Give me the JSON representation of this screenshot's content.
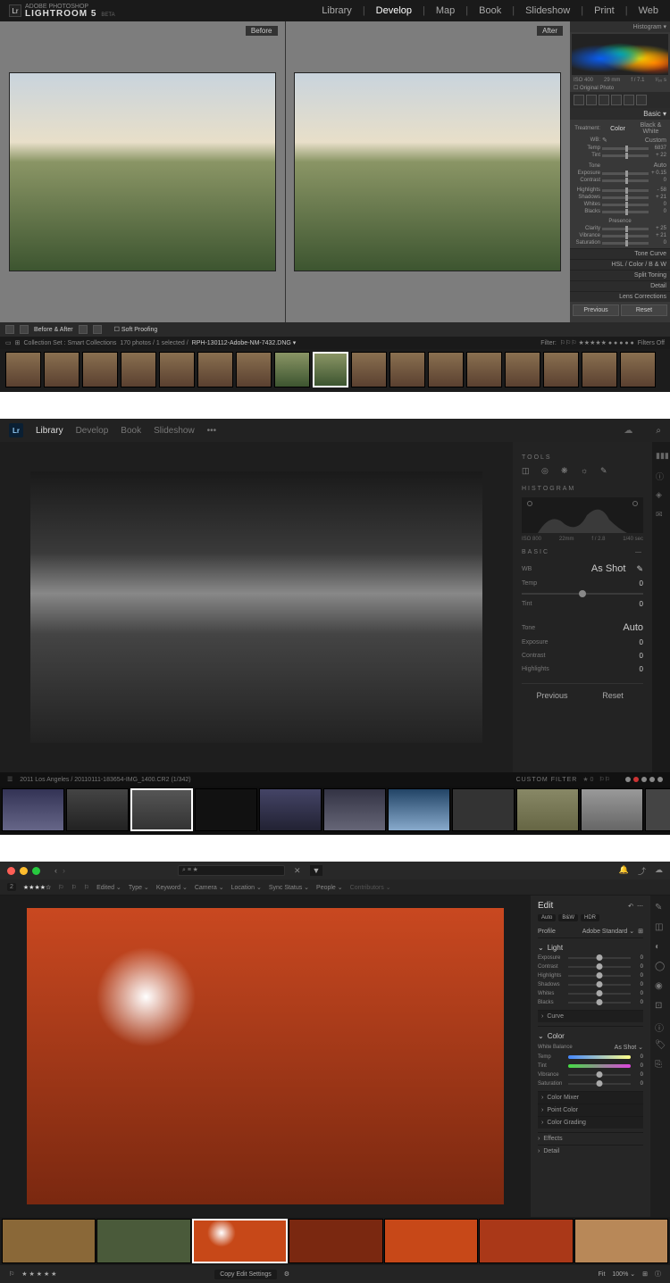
{
  "lr5": {
    "brand_small": "ADOBE PHOTOSHOP",
    "brand_big": "LIGHTROOM 5",
    "brand_beta": "BETA",
    "logo": "Lr",
    "modules": [
      "Library",
      "Develop",
      "Map",
      "Book",
      "Slideshow",
      "Print",
      "Web"
    ],
    "active_module": "Develop",
    "before_label": "Before",
    "after_label": "After",
    "histogram_title": "Histogram ▾",
    "hist_meta": {
      "iso": "ISO 400",
      "focal": "29 mm",
      "aperture": "f / 7.1",
      "shutter": "¹⁄₆₀ s"
    },
    "original_photo": "Original Photo",
    "basic_title": "Basic ▾",
    "treatment": {
      "label": "Treatment:",
      "color": "Color",
      "bw": "Black & White"
    },
    "wb": {
      "label": "WB:",
      "value": "Custom"
    },
    "temp": {
      "label": "Temp",
      "value": "6837"
    },
    "tint": {
      "label": "Tint",
      "value": "+ 22"
    },
    "tone_label": "Tone",
    "auto_label": "Auto",
    "exposure": {
      "label": "Exposure",
      "value": "+ 0.15"
    },
    "contrast": {
      "label": "Contrast",
      "value": "0"
    },
    "highlights": {
      "label": "Highlights",
      "value": "- 58"
    },
    "shadows": {
      "label": "Shadows",
      "value": "+ 21"
    },
    "whites": {
      "label": "Whites",
      "value": "0"
    },
    "blacks": {
      "label": "Blacks",
      "value": "0"
    },
    "presence_label": "Presence",
    "clarity": {
      "label": "Clarity",
      "value": "+ 25"
    },
    "vibrance": {
      "label": "Vibrance",
      "value": "+ 21"
    },
    "saturation": {
      "label": "Saturation",
      "value": "0"
    },
    "collapsed": [
      "Tone Curve",
      "HSL  /  Color  /  B & W",
      "Split Toning",
      "Detail",
      "Lens Corrections"
    ],
    "previous_btn": "Previous",
    "reset_btn": "Reset",
    "toolbar": {
      "mode": "Before & After",
      "soft": "Soft Proofing"
    },
    "filmstrip_header": {
      "collection": "Collection Set : Smart Collections",
      "count": "170 photos / 1 selected /",
      "file": "RPH-130112-Adobe-NM-7432.DNG ▾",
      "filter_label": "Filter:",
      "filters_off": "Filters Off"
    }
  },
  "lrcc": {
    "logo": "Lr",
    "modules": [
      "Library",
      "Develop",
      "Book",
      "Slideshow",
      "•••"
    ],
    "active": "Library",
    "tools_title": "TOOLS",
    "histogram_title": "HISTOGRAM",
    "meta": {
      "iso": "ISO 800",
      "focal": "22mm",
      "aperture": "f / 2.8",
      "shutter": "1/40 sec"
    },
    "basic_title": "BASIC",
    "wb": {
      "label": "WB",
      "value": "As Shot"
    },
    "temp": {
      "label": "Temp",
      "value": "0"
    },
    "tint": {
      "label": "Tint",
      "value": "0"
    },
    "tone": {
      "label": "Tone",
      "value": "Auto"
    },
    "exposure": {
      "label": "Exposure",
      "value": "0"
    },
    "contrast": {
      "label": "Contrast",
      "value": "0"
    },
    "highlights": {
      "label": "Highlights",
      "value": "0"
    },
    "previous_btn": "Previous",
    "reset_btn": "Reset",
    "breadcrumb": "2011 Los Angeles  /  20110111-183654-IMG_1400.CR2 (1/342)",
    "custom_filter": "CUSTOM FILTER",
    "star": "★ 0",
    "dot_colors": [
      "#888",
      "#888",
      "#c33",
      "#888",
      "#888",
      "#888"
    ]
  },
  "lr3": {
    "traffic": [
      "#ff5f56",
      "#ffbd2e",
      "#27c93f"
    ],
    "search_text": "⌕  ≡ ★",
    "rating_display": "★★★★☆",
    "count_badge": "2",
    "filters": [
      {
        "label": "Edited ⌄"
      },
      {
        "label": "Type ⌄"
      },
      {
        "label": "Keyword ⌄"
      },
      {
        "label": "Camera ⌄"
      },
      {
        "label": "Location ⌄"
      },
      {
        "label": "Sync Status ⌄"
      },
      {
        "label": "People ⌄"
      },
      {
        "label": "Contributors ⌄"
      }
    ],
    "edit_title": "Edit",
    "pills": [
      "Auto",
      "B&W",
      "HDR"
    ],
    "profile": {
      "label": "Profile",
      "value": "Adobe Standard ⌄"
    },
    "light_title": "Light",
    "light_sliders": [
      {
        "label": "Exposure",
        "v": "0"
      },
      {
        "label": "Contrast",
        "v": "0"
      },
      {
        "label": "Highlights",
        "v": "0"
      },
      {
        "label": "Shadows",
        "v": "0"
      },
      {
        "label": "Whites",
        "v": "0"
      },
      {
        "label": "Blacks",
        "v": "0"
      }
    ],
    "curve_label": "Curve",
    "color_title": "Color",
    "wb": {
      "label": "White Balance",
      "value": "As Shot ⌄"
    },
    "temp": {
      "label": "Temp",
      "v": "0"
    },
    "tint": {
      "label": "Tint",
      "v": "0"
    },
    "vibrance": {
      "label": "Vibrance",
      "v": "0"
    },
    "saturation": {
      "label": "Saturation",
      "v": "0"
    },
    "collapsed": [
      "Color Mixer",
      "Point Color",
      "Color Grading"
    ],
    "effects": "Effects",
    "detail": "Detail",
    "bottom": {
      "copy": "Copy Edit Settings",
      "fit": "Fit",
      "zoom": "100% ⌄"
    },
    "film_colors": [
      "#8a6838",
      "#4a5a3a",
      "#c74818",
      "#7a2810",
      "#c74818",
      "#aa3818",
      "#b88858"
    ]
  }
}
